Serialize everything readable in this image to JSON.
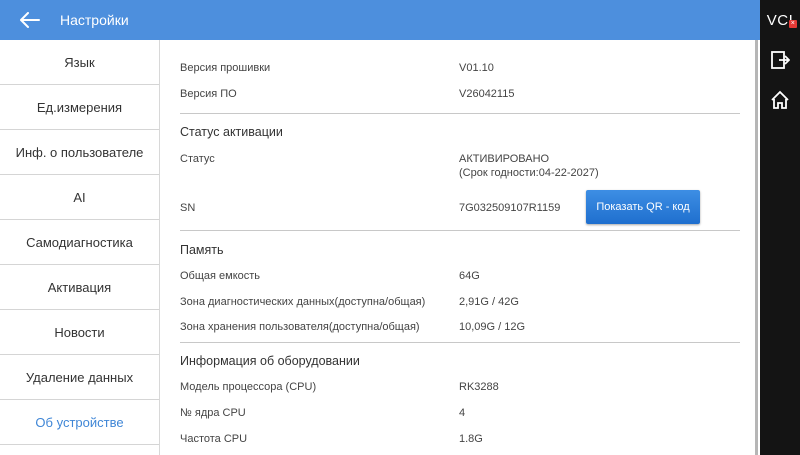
{
  "header": {
    "title": "Настройки"
  },
  "rightbar": {
    "vci_label": "VCI",
    "vci_badge": "×"
  },
  "sidebar": {
    "items": [
      {
        "label": "Язык"
      },
      {
        "label": "Ед.измерения"
      },
      {
        "label": "Инф. о пользователе"
      },
      {
        "label": "AI"
      },
      {
        "label": "Самодиагностика"
      },
      {
        "label": "Активация"
      },
      {
        "label": "Новости"
      },
      {
        "label": "Удаление данных"
      },
      {
        "label": "Об устройстве"
      }
    ],
    "active_index": 8
  },
  "firmware": {
    "firmware_label": "Версия прошивки",
    "firmware_value": "V01.10",
    "software_label": "Версия ПО",
    "software_value": "V26042115"
  },
  "activation": {
    "section_title": "Статус активации",
    "status_label": "Статус",
    "status_value": "АКТИВИРОВАНО",
    "expiry": "(Срок годности:04-22-2027)",
    "sn_label": "SN",
    "sn_value": "7G032509107R1159",
    "qr_button": "Показать QR - код"
  },
  "memory": {
    "section_title": "Память",
    "total_label": "Общая емкость",
    "total_value": "64G",
    "diag_label": "Зона диагностических данных(доступна/общая)",
    "diag_value": "2,91G / 42G",
    "user_label": "Зона хранения пользователя(доступна/общая)",
    "user_value": "10,09G / 12G"
  },
  "hardware": {
    "section_title": "Информация об оборудовании",
    "cpu_model_label": "Модель процессора (CPU)",
    "cpu_model_value": "RK3288",
    "cpu_cores_label": "№ ядра CPU",
    "cpu_cores_value": "4",
    "cpu_freq_label": "Частота CPU",
    "cpu_freq_value": "1.8G"
  }
}
